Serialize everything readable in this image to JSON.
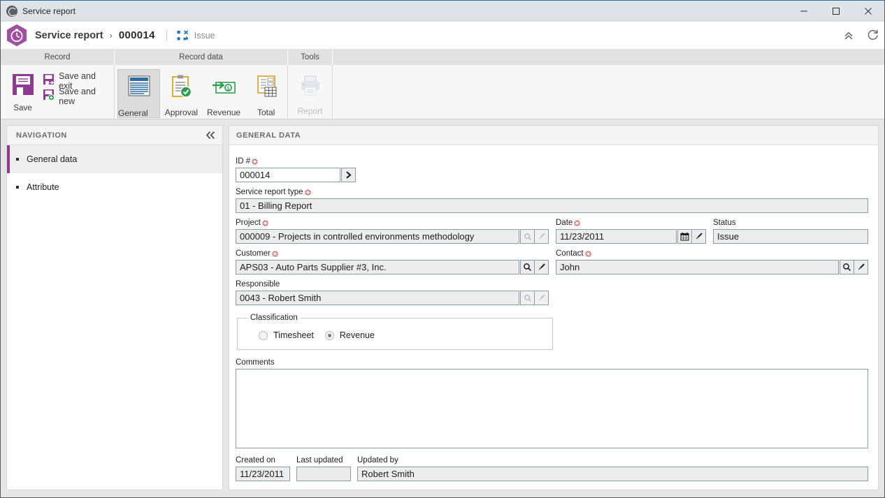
{
  "window": {
    "title": "Service report",
    "app_icon": "globe-icon",
    "controls": {
      "minimize": "minimize-icon",
      "maximize": "maximize-icon",
      "close": "close-icon"
    }
  },
  "breadcrumb": {
    "module_icon": "stopwatch-hex-icon",
    "title": "Service report",
    "separator": "›",
    "record_id": "000014",
    "status_icon": "issue-icon",
    "status_label": "Issue",
    "collapse_icon": "chevron-double-up-icon",
    "refresh_icon": "refresh-icon"
  },
  "ribbon": {
    "groups": [
      {
        "name": "Record",
        "label": "Record",
        "big_button": {
          "label": "Save",
          "icon": "save-floppy-icon"
        },
        "small_buttons": [
          {
            "label": "Save and exit",
            "icon": "save-and-exit-icon"
          },
          {
            "label": "Save and new",
            "icon": "save-and-new-icon"
          }
        ]
      },
      {
        "name": "Record data",
        "label": "Record data",
        "buttons": [
          {
            "label": "General data",
            "icon": "document-lines-icon",
            "active": true,
            "disabled": false
          },
          {
            "label": "Approval",
            "icon": "clipboard-check-icon",
            "active": false,
            "disabled": false
          },
          {
            "label": "Revenue",
            "icon": "money-bill-icon",
            "active": false,
            "disabled": false
          },
          {
            "label": "Total",
            "icon": "notebook-table-icon",
            "active": false,
            "disabled": false
          }
        ]
      },
      {
        "name": "Tools",
        "label": "Tools",
        "buttons": [
          {
            "label": "Report",
            "icon": "printer-icon",
            "active": false,
            "disabled": true
          }
        ]
      }
    ]
  },
  "navigation": {
    "header": "NAVIGATION",
    "collapse_icon": "chevron-double-left-icon",
    "items": [
      {
        "label": "General data",
        "selected": true
      },
      {
        "label": "Attribute",
        "selected": false
      }
    ]
  },
  "content": {
    "header": "GENERAL DATA",
    "fields": {
      "id": {
        "label": "ID #",
        "required": true,
        "value": "000014",
        "button_icon": "chevron-right-icon"
      },
      "service_report_type": {
        "label": "Service report type",
        "required": true,
        "value": "01 - Billing Report"
      },
      "project": {
        "label": "Project",
        "required": true,
        "value": "000009 - Projects in controlled environments methodology",
        "search_icon": "magnifier-icon",
        "clear_icon": "brush-icon",
        "buttons_disabled": true
      },
      "date": {
        "label": "Date",
        "required": true,
        "value": "11/23/2011",
        "calendar_icon": "calendar-icon",
        "clear_icon": "brush-icon"
      },
      "status": {
        "label": "Status",
        "required": false,
        "value": "Issue"
      },
      "customer": {
        "label": "Customer",
        "required": true,
        "value": "APS03 - Auto Parts Supplier #3, Inc.",
        "search_icon": "magnifier-icon",
        "clear_icon": "brush-icon",
        "buttons_disabled": false
      },
      "contact": {
        "label": "Contact",
        "required": true,
        "value": "John",
        "search_icon": "magnifier-icon",
        "clear_icon": "brush-icon",
        "buttons_disabled": false
      },
      "responsible": {
        "label": "Responsible",
        "required": false,
        "value": "0043 - Robert Smith",
        "search_icon": "magnifier-icon",
        "clear_icon": "brush-icon",
        "buttons_disabled": true
      },
      "classification": {
        "legend": "Classification",
        "options": [
          {
            "label": "Timesheet",
            "checked": false
          },
          {
            "label": "Revenue",
            "checked": true
          }
        ]
      },
      "comments": {
        "label": "Comments",
        "value": ""
      },
      "created_on": {
        "label": "Created on",
        "value": "11/23/2011"
      },
      "last_updated": {
        "label": "Last updated",
        "value": ""
      },
      "updated_by": {
        "label": "Updated by",
        "value": "Robert Smith"
      }
    }
  },
  "colors": {
    "accent_purple": "#8e3a91",
    "title_bar": "#dfe3e8",
    "window_border_top": "#2f6fb0",
    "field_border": "#8a9ba8",
    "required_marker": "#d33a2c",
    "nav_selected_bg": "#eeeeee"
  }
}
